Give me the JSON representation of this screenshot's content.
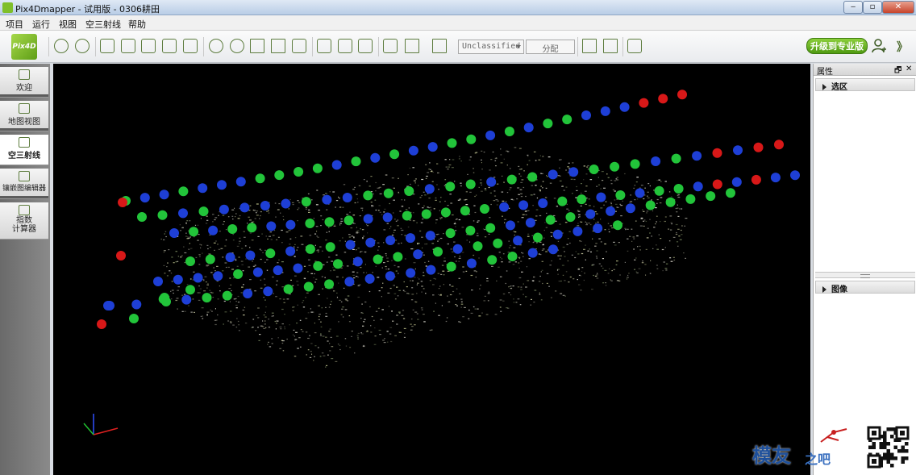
{
  "window": {
    "title": "Pix4Dmapper - 试用版 - 0306耕田",
    "minimize": "‒",
    "maximize": "▫",
    "close": "✕"
  },
  "menu": {
    "items": [
      "项目",
      "运行",
      "视图",
      "空三射线",
      "帮助"
    ]
  },
  "toolbar": {
    "logo_text": "Pix4D",
    "classification_value": "Unclassified",
    "classify_label": "分配",
    "upgrade_label": "升级到专业版",
    "expand_label": "》"
  },
  "sidebar": {
    "items": [
      {
        "label": "欢迎",
        "icon": "home-icon",
        "active": false
      },
      {
        "label": "地图视图",
        "icon": "map-icon",
        "active": false
      },
      {
        "label": "空三射线",
        "icon": "rays-icon",
        "active": true
      },
      {
        "label": "镶嵌图编辑器",
        "icon": "mosaic-icon",
        "active": false
      },
      {
        "label": "指数",
        "label2": "计算器",
        "icon": "calculator-icon",
        "active": false
      }
    ]
  },
  "right_panel": {
    "title": "属性",
    "pin": "🗗",
    "close": "✕",
    "section_selection": "选区",
    "section_images": "图像"
  },
  "watermark": {
    "text": "模友",
    "sub": "之吧"
  },
  "colors": {
    "accent_green": "#6db22a",
    "camera_green": "#22c43a",
    "camera_blue": "#1e3fd6",
    "camera_red": "#d81818",
    "viewport_bg": "#000000"
  }
}
